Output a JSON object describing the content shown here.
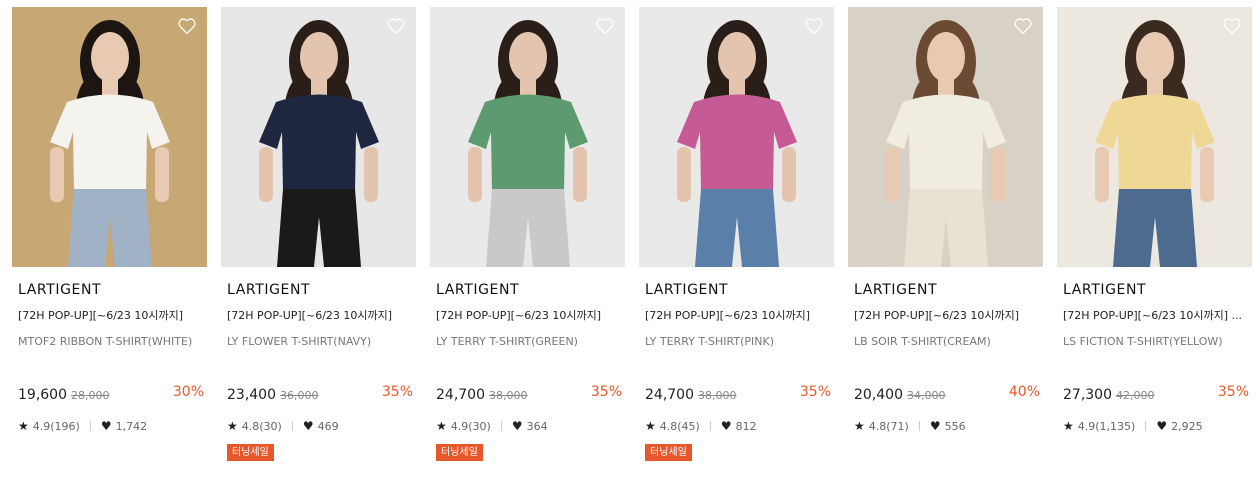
{
  "colors": {
    "discount": "#e8572a",
    "badge_bg": "#e8572a"
  },
  "products": [
    {
      "brand": "LARTIGENT",
      "promo": "[72H POP-UP][~6/23 10시까지]",
      "name": "MTOF2 RIBBON T-SHIRT(WHITE)",
      "price": "19,600",
      "original_price": "28,000",
      "discount": "30%",
      "rating": "4.9(196)",
      "likes": "1,742",
      "badge": "",
      "image": {
        "bg": "#c7a874",
        "shirt": "#f4f3ee",
        "pants": "#9fb2c6",
        "hair": "#1c1512",
        "skin": "#e8c9b2"
      }
    },
    {
      "brand": "LARTIGENT",
      "promo": "[72H POP-UP][~6/23 10시까지]",
      "name": "LY FLOWER T-SHIRT(NAVY)",
      "price": "23,400",
      "original_price": "36,000",
      "discount": "35%",
      "rating": "4.8(30)",
      "likes": "469",
      "badge": "터닝세일",
      "image": {
        "bg": "#e7e7e7",
        "shirt": "#1f2640",
        "pants": "#1a1a1a",
        "hair": "#2a1e18",
        "skin": "#e3c4ae"
      }
    },
    {
      "brand": "LARTIGENT",
      "promo": "[72H POP-UP][~6/23 10시까지]",
      "name": "LY TERRY T-SHIRT(GREEN)",
      "price": "24,700",
      "original_price": "38,000",
      "discount": "35%",
      "rating": "4.9(30)",
      "likes": "364",
      "badge": "터닝세일",
      "image": {
        "bg": "#e9e9e9",
        "shirt": "#5e9a6f",
        "pants": "#c9c9c9",
        "hair": "#2a1e18",
        "skin": "#e3c4ae"
      }
    },
    {
      "brand": "LARTIGENT",
      "promo": "[72H POP-UP][~6/23 10시까지]",
      "name": "LY TERRY T-SHIRT(PINK)",
      "price": "24,700",
      "original_price": "38,000",
      "discount": "35%",
      "rating": "4.8(45)",
      "likes": "812",
      "badge": "터닝세일",
      "image": {
        "bg": "#e9e9e9",
        "shirt": "#c65a94",
        "pants": "#5a7fa8",
        "hair": "#2a1e18",
        "skin": "#e3c4ae"
      }
    },
    {
      "brand": "LARTIGENT",
      "promo": "[72H POP-UP][~6/23 10시까지]",
      "name": "LB SOIR T-SHIRT(CREAM)",
      "price": "20,400",
      "original_price": "34,000",
      "discount": "40%",
      "rating": "4.8(71)",
      "likes": "556",
      "badge": "",
      "image": {
        "bg": "#d8d2c6",
        "shirt": "#f1ece0",
        "pants": "#e8e2d4",
        "hair": "#6b4a33",
        "skin": "#e8c9b2"
      }
    },
    {
      "brand": "LARTIGENT",
      "promo": "[72H POP-UP][~6/23 10시까지] ...",
      "name": "LS FICTION T-SHIRT(YELLOW)",
      "price": "27,300",
      "original_price": "42,000",
      "discount": "35%",
      "rating": "4.9(1,135)",
      "likes": "2,925",
      "badge": "",
      "image": {
        "bg": "#ece8df",
        "shirt": "#efd796",
        "pants": "#4d6a8f",
        "hair": "#3a2a20",
        "skin": "#e8c9b2"
      }
    }
  ]
}
